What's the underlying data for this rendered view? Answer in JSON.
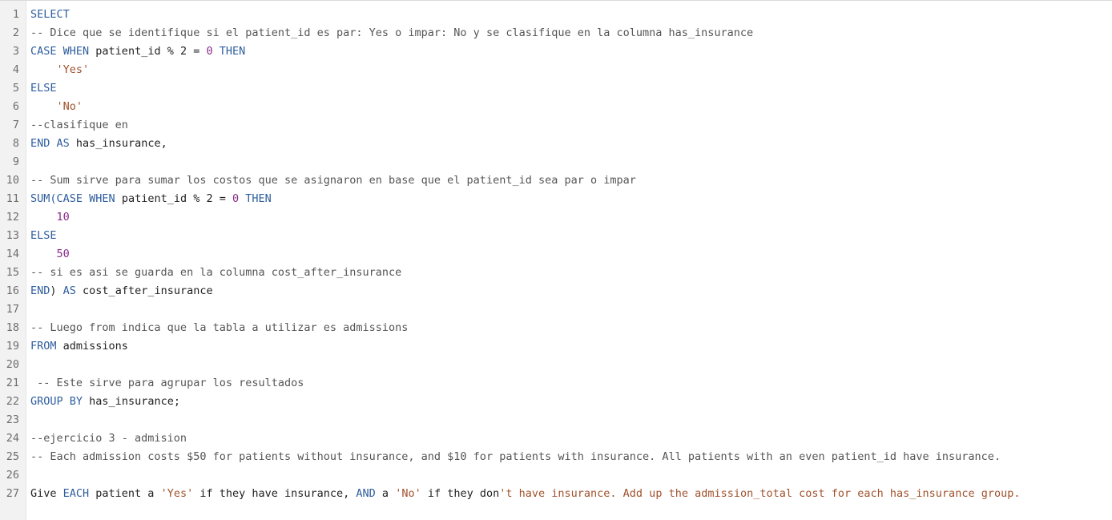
{
  "colors": {
    "keyword": "#2f5e9e",
    "plain": "#222222",
    "string": "#a0522d",
    "number": "#8a2b8a",
    "comment": "#555555",
    "gutter_bg": "#f2f2f2",
    "line_number": "#6e6e6e"
  },
  "editor": {
    "lines": [
      {
        "num": "1",
        "tokens": [
          {
            "t": "SELECT",
            "k": "kw"
          }
        ]
      },
      {
        "num": "2",
        "tokens": [
          {
            "t": "-- Dice que se identifique si el patient_id es par: Yes o impar: No y se clasifique en la columna has_insurance",
            "k": "cm"
          }
        ]
      },
      {
        "num": "3",
        "tokens": [
          {
            "t": "CASE",
            "k": "kw"
          },
          {
            "t": " ",
            "k": "plain"
          },
          {
            "t": "WHEN",
            "k": "kw"
          },
          {
            "t": " patient_id % 2 = ",
            "k": "plain"
          },
          {
            "t": "0",
            "k": "num"
          },
          {
            "t": " ",
            "k": "plain"
          },
          {
            "t": "THEN",
            "k": "kw"
          }
        ]
      },
      {
        "num": "4",
        "tokens": [
          {
            "t": "    ",
            "k": "plain"
          },
          {
            "t": "'Yes'",
            "k": "str"
          }
        ]
      },
      {
        "num": "5",
        "tokens": [
          {
            "t": "ELSE",
            "k": "kw"
          }
        ]
      },
      {
        "num": "6",
        "tokens": [
          {
            "t": "    ",
            "k": "plain"
          },
          {
            "t": "'No'",
            "k": "str"
          }
        ]
      },
      {
        "num": "7",
        "tokens": [
          {
            "t": "--clasifique en",
            "k": "cm"
          }
        ]
      },
      {
        "num": "8",
        "tokens": [
          {
            "t": "END",
            "k": "kw"
          },
          {
            "t": " ",
            "k": "plain"
          },
          {
            "t": "AS",
            "k": "kw"
          },
          {
            "t": " has_insurance,",
            "k": "plain"
          }
        ]
      },
      {
        "num": "9",
        "tokens": []
      },
      {
        "num": "10",
        "tokens": [
          {
            "t": "-- Sum sirve para sumar los costos que se asignaron en base que el patient_id sea par o impar",
            "k": "cm"
          }
        ]
      },
      {
        "num": "11",
        "tokens": [
          {
            "t": "SUM(",
            "k": "kw"
          },
          {
            "t": "CASE",
            "k": "kw"
          },
          {
            "t": " ",
            "k": "plain"
          },
          {
            "t": "WHEN",
            "k": "kw"
          },
          {
            "t": " patient_id % 2 = ",
            "k": "plain"
          },
          {
            "t": "0",
            "k": "num"
          },
          {
            "t": " ",
            "k": "plain"
          },
          {
            "t": "THEN",
            "k": "kw"
          }
        ]
      },
      {
        "num": "12",
        "tokens": [
          {
            "t": "    ",
            "k": "plain"
          },
          {
            "t": "10",
            "k": "num"
          }
        ]
      },
      {
        "num": "13",
        "tokens": [
          {
            "t": "ELSE",
            "k": "kw"
          }
        ]
      },
      {
        "num": "14",
        "tokens": [
          {
            "t": "    ",
            "k": "plain"
          },
          {
            "t": "50",
            "k": "num"
          }
        ]
      },
      {
        "num": "15",
        "tokens": [
          {
            "t": "-- si es asi se guarda en la columna cost_after_insurance",
            "k": "cm"
          }
        ]
      },
      {
        "num": "16",
        "tokens": [
          {
            "t": "END",
            "k": "kw"
          },
          {
            "t": ") ",
            "k": "plain"
          },
          {
            "t": "AS",
            "k": "kw"
          },
          {
            "t": " cost_after_insurance",
            "k": "plain"
          }
        ]
      },
      {
        "num": "17",
        "tokens": []
      },
      {
        "num": "18",
        "tokens": [
          {
            "t": "-- Luego from indica que la tabla a utilizar es admissions",
            "k": "cm"
          }
        ]
      },
      {
        "num": "19",
        "tokens": [
          {
            "t": "FROM",
            "k": "kw"
          },
          {
            "t": " admissions",
            "k": "plain"
          }
        ]
      },
      {
        "num": "20",
        "tokens": []
      },
      {
        "num": "21",
        "tokens": [
          {
            "t": " -- Este sirve para agrupar los resultados",
            "k": "cm"
          }
        ]
      },
      {
        "num": "22",
        "tokens": [
          {
            "t": "GROUP",
            "k": "kw"
          },
          {
            "t": " ",
            "k": "plain"
          },
          {
            "t": "BY",
            "k": "kw"
          },
          {
            "t": " has_insurance;",
            "k": "plain"
          }
        ]
      },
      {
        "num": "23",
        "tokens": []
      },
      {
        "num": "24",
        "tokens": [
          {
            "t": "--ejercicio 3 - admision",
            "k": "cm"
          }
        ]
      },
      {
        "num": "25",
        "tokens": [
          {
            "t": "-- Each admission costs $50 for patients without insurance, and $10 for patients with insurance. All patients with an even patient_id have insurance.",
            "k": "cm"
          }
        ]
      },
      {
        "num": "26",
        "tokens": []
      },
      {
        "num": "27",
        "tokens": [
          {
            "t": "Give ",
            "k": "plain"
          },
          {
            "t": "EACH",
            "k": "kw"
          },
          {
            "t": " patient a ",
            "k": "plain"
          },
          {
            "t": "'Yes'",
            "k": "str"
          },
          {
            "t": " if they have insurance, ",
            "k": "plain"
          },
          {
            "t": "AND",
            "k": "kw"
          },
          {
            "t": " a ",
            "k": "plain"
          },
          {
            "t": "'No'",
            "k": "str"
          },
          {
            "t": " if they don",
            "k": "plain"
          },
          {
            "t": "'t have insurance. Add up the admission_total cost for each has_insurance group.",
            "k": "str"
          }
        ]
      }
    ]
  }
}
